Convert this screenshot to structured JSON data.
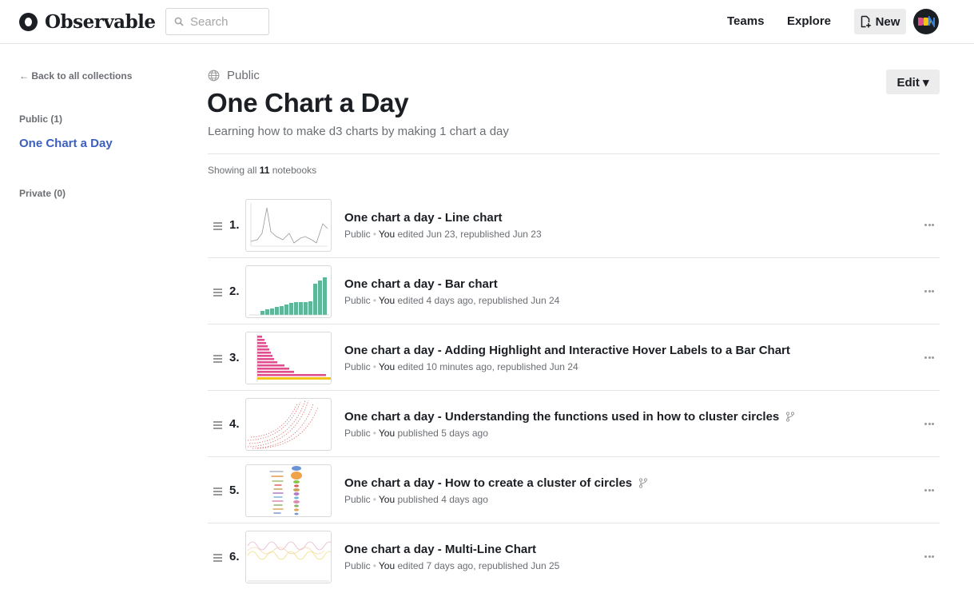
{
  "header": {
    "brand": "Observable",
    "search_placeholder": "Search",
    "nav": {
      "teams": "Teams",
      "explore": "Explore"
    },
    "new_label": "New"
  },
  "sidebar": {
    "back_label": "← Back to all collections",
    "public_heading": "Public (1)",
    "collections": [
      "One Chart a Day"
    ],
    "private_heading": "Private (0)"
  },
  "collection": {
    "visibility": "Public",
    "title": "One Chart a Day",
    "description": "Learning how to make d3 charts by making 1 chart a day",
    "edit_label": "Edit ▾",
    "showing_prefix": "Showing all",
    "count": "11",
    "showing_suffix": "notebooks"
  },
  "notebooks": [
    {
      "num": "1.",
      "title": "One chart a day - Line chart",
      "visibility": "Public",
      "who": "You",
      "action": "edited Jun 23, republished Jun 23",
      "forked": false
    },
    {
      "num": "2.",
      "title": "One chart a day - Bar chart",
      "visibility": "Public",
      "who": "You",
      "action": "edited 4 days ago, republished Jun 24",
      "forked": false
    },
    {
      "num": "3.",
      "title": "One chart a day - Adding Highlight and Interactive Hover Labels to a Bar Chart",
      "visibility": "Public",
      "who": "You",
      "action": "edited 10 minutes ago, republished Jun 24",
      "forked": false
    },
    {
      "num": "4.",
      "title": "One chart a day - Understanding the functions used in how to cluster circles",
      "visibility": "Public",
      "who": "You",
      "action": "published 5 days ago",
      "forked": true
    },
    {
      "num": "5.",
      "title": "One chart a day - How to create a cluster of circles",
      "visibility": "Public",
      "who": "You",
      "action": "published 4 days ago",
      "forked": true
    },
    {
      "num": "6.",
      "title": "One chart a day - Multi-Line Chart",
      "visibility": "Public",
      "who": "You",
      "action": "edited 7 days ago, republished Jun 25",
      "forked": false
    }
  ],
  "colors": {
    "accent": "#3b5fc0",
    "bar_green": "#5fb79a",
    "bar_pink": "#e0508f",
    "highlight_yellow": "#f2c418",
    "dots_red": "#d95b5b"
  }
}
